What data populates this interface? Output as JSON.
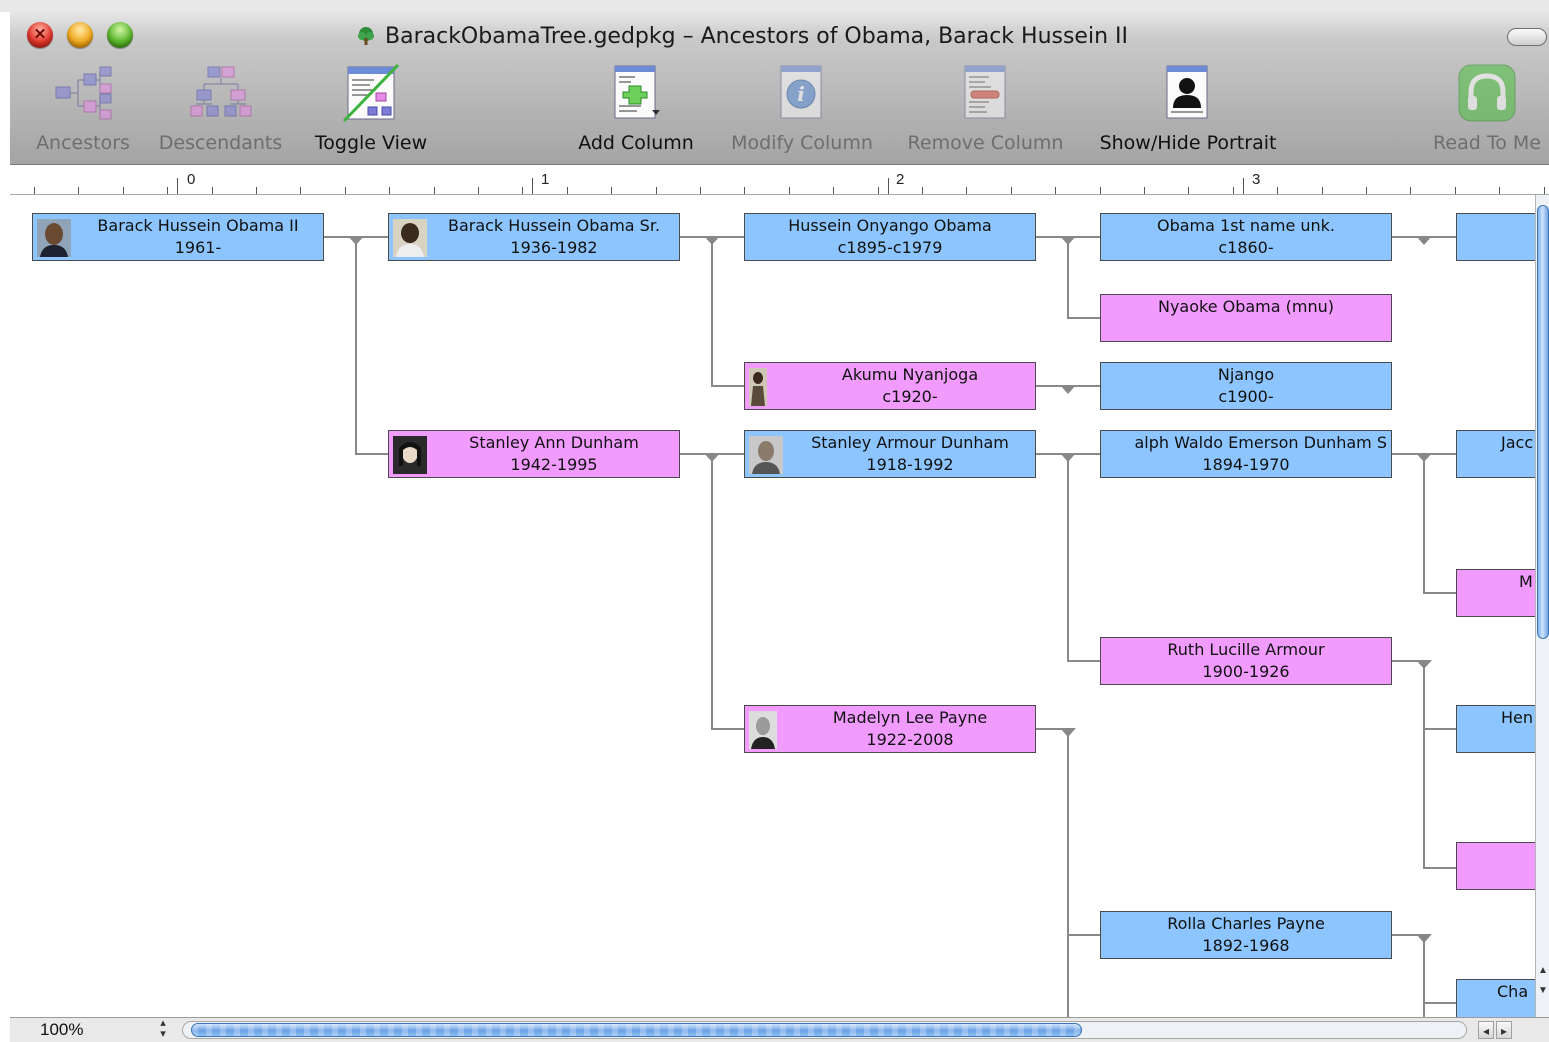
{
  "window": {
    "title": "BarackObamaTree.gedpkg – Ancestors of Obama, Barack Hussein II",
    "close_glyph": "✕"
  },
  "toolbar": {
    "ancestors": "Ancestors",
    "descendants": "Descendants",
    "toggle_view": "Toggle View",
    "add_column": "Add Column",
    "modify_column": "Modify Column",
    "remove_column": "Remove Column",
    "show_hide_portrait": "Show/Hide Portrait",
    "read_to_me": "Read To Me"
  },
  "ruler": {
    "labels": [
      "0",
      "1",
      "2",
      "3"
    ]
  },
  "people": {
    "p0": {
      "name": "Barack Hussein Obama II",
      "dates": "1961-"
    },
    "p1": {
      "name": "Barack Hussein Obama Sr.",
      "dates": "1936-1982"
    },
    "p2": {
      "name": "Stanley Ann Dunham",
      "dates": "1942-1995"
    },
    "p3": {
      "name": "Hussein Onyango Obama",
      "dates": "c1895-c1979"
    },
    "p4": {
      "name": "Akumu Nyanjoga",
      "dates": "c1920-"
    },
    "p5": {
      "name": "Stanley Armour Dunham",
      "dates": "1918-1992"
    },
    "p6": {
      "name": "Madelyn Lee Payne",
      "dates": "1922-2008"
    },
    "p7": {
      "name": "Obama 1st name unk.",
      "dates": "c1860-"
    },
    "p8": {
      "name": "Nyaoke Obama (mnu)",
      "dates": ""
    },
    "p9": {
      "name": "Njango",
      "dates": "c1900-"
    },
    "p10": {
      "name": "alph Waldo Emerson Dunham S",
      "dates": "1894-1970"
    },
    "p11": {
      "name": "Ruth Lucille Armour",
      "dates": "1900-1926"
    },
    "p12": {
      "name": "Rolla Charles Payne",
      "dates": "1892-1968"
    },
    "p13": {
      "name": "",
      "dates": ""
    },
    "p14": {
      "name": "Jacc",
      "dates": ""
    },
    "p15": {
      "name": "M",
      "dates": ""
    },
    "p16": {
      "name": "Hen",
      "dates": ""
    },
    "p17": {
      "name": "",
      "dates": ""
    },
    "p18": {
      "name": "Cha",
      "dates": ""
    }
  },
  "status": {
    "zoom": "100%"
  },
  "scroll": {
    "horizontal_fraction": 0.7,
    "vertical_fraction": 0.57
  },
  "colors": {
    "male": "#8cc5ff",
    "female": "#f19bff",
    "connector": "#888888"
  }
}
